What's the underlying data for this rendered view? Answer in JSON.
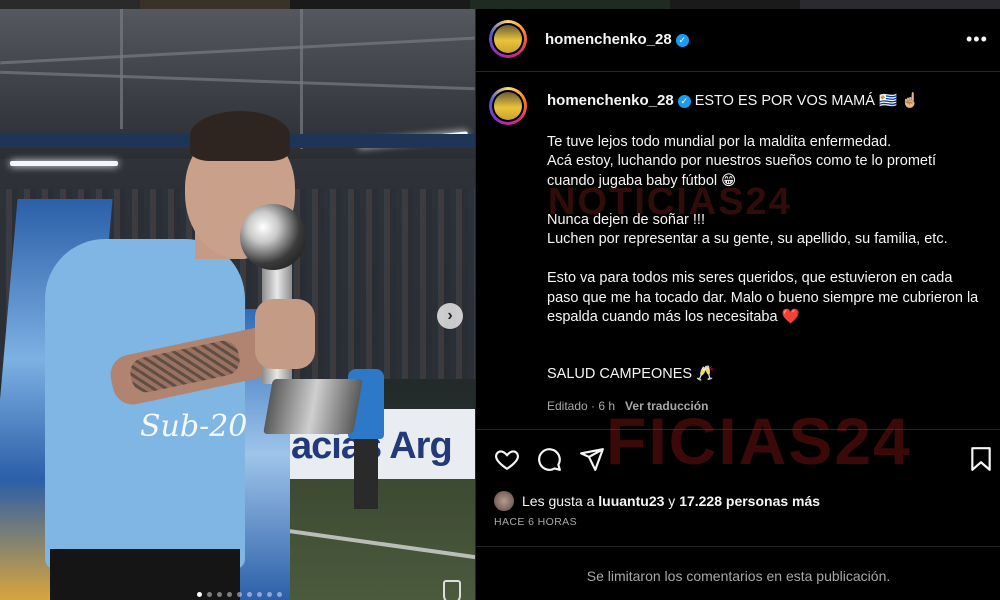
{
  "post": {
    "username": "homenchenko_28",
    "verified_mark": "✓",
    "more_menu": "•••",
    "caption_first_line": "ESTO ES POR VOS MAMÁ 🇺🇾 ☝🏼",
    "paragraphs": [
      "Te tuve lejos todo mundial por la maldita enfermedad.\nAcá estoy, luchando por nuestros sueños como te lo prometí cuando jugaba baby fútbol 😁",
      "Nunca dejen de soñar !!!\nLuchen por representar a su gente, su apellido, su familia, etc.",
      "Esto va para todos mis seres queridos, que estuvieron en cada paso que me ha tocado dar. Malo o bueno siempre me cubrieron la espalda cuando más los necesitaba ❤️",
      "SALUD CAMPEONES 🥂"
    ],
    "edited_meta": "Editado · 6 h",
    "translate_link": "Ver traducción",
    "likes_prefix": "Les gusta a",
    "likes_user": "luuantu23",
    "likes_mid": "y",
    "likes_count": "17.228 personas más",
    "time_ago": "HACE 6 HORAS",
    "comments_limited": "Se limitaron los comentarios en esta publicación."
  },
  "photo": {
    "jersey_text": "Sub-20",
    "banner_text": "acias Arg",
    "carousel_total": 9,
    "carousel_active": 1
  },
  "watermark": {
    "text_top": "NOTICIAS24",
    "text_bottom": "FICIAS24"
  },
  "icons": {
    "like": "heart-icon",
    "comment": "comment-icon",
    "share": "send-icon",
    "save": "bookmark-icon",
    "next": "chevron-right-icon"
  },
  "colors": {
    "verified": "#1d9bf0",
    "heart": "#ed4956",
    "background": "#000000",
    "muted": "#a8a8a8"
  }
}
